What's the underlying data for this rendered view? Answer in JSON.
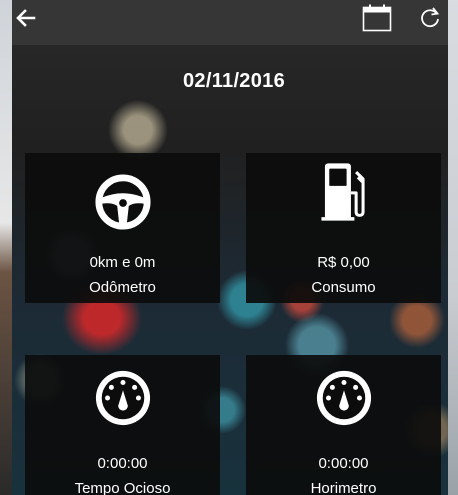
{
  "header": {
    "back": "back-arrow-icon",
    "calendar": "calendar-icon",
    "refresh": "refresh-icon"
  },
  "date": "02/11/2016",
  "cards": [
    {
      "icon": "steering-wheel-icon",
      "value": "0km e 0m",
      "label": "Odômetro"
    },
    {
      "icon": "fuel-pump-icon",
      "value": "R$ 0,00",
      "label": "Consumo"
    },
    {
      "icon": "gauge-icon",
      "value": "0:00:00",
      "label": "Tempo Ocioso"
    },
    {
      "icon": "gauge-icon",
      "value": "0:00:00",
      "label": "Horimetro"
    }
  ]
}
